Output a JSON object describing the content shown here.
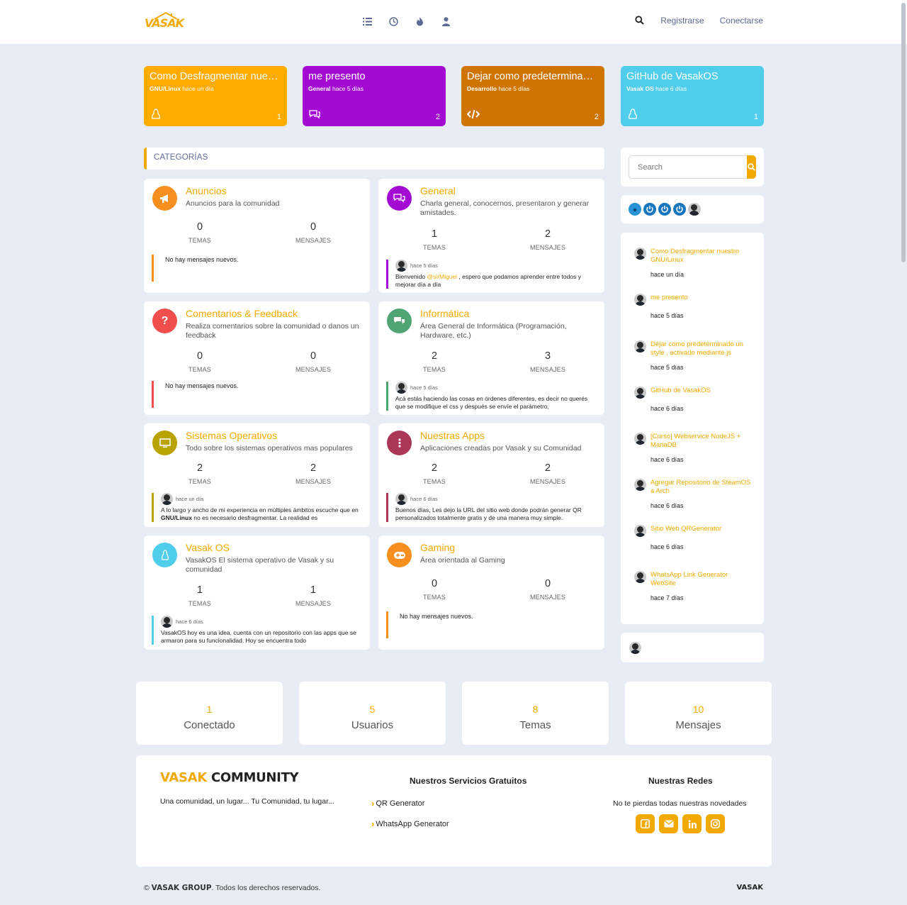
{
  "brand": {
    "logo": "VASAK"
  },
  "topnav": {
    "icons": [
      "list-icon",
      "clock-icon",
      "fire-icon",
      "user-icon"
    ],
    "register": "Registrarse",
    "login": "Conectarse"
  },
  "recent_cards": [
    {
      "title": "Como Desfragmentar nuestr...",
      "category": "GNU/Linux",
      "time": "hace un día",
      "count": "1",
      "color": "#ffab00",
      "icon": "linux-icon"
    },
    {
      "title": "me presento",
      "category": "General",
      "time": "hace 5 días",
      "count": "2",
      "color": "#a30bd3",
      "icon": "comments-icon"
    },
    {
      "title": "Dejar como predeterminado ...",
      "category": "Desarrollo",
      "time": "hace 5 días",
      "count": "2",
      "color": "#cf7400",
      "icon": "code-icon"
    },
    {
      "title": "GitHub de VasakOS",
      "category": "Vasak OS",
      "time": "hace 6 días",
      "count": "1",
      "color": "#4fcdea",
      "icon": "linux-icon"
    }
  ],
  "categories_header": "CATEGORÍAS",
  "categories": [
    {
      "title": "Anuncios",
      "desc": "Anuncios para la comunidad",
      "topics": "0",
      "posts": "0",
      "color": "#f68f1f",
      "icon": "megaphone-icon",
      "last": null
    },
    {
      "title": "General",
      "desc": "Charla general, conocernos, presentaron y generar amistades.",
      "topics": "1",
      "posts": "2",
      "color": "#a30bd3",
      "icon": "comments-icon",
      "last": {
        "time": "hace 5 días",
        "pre": "Bienvenido ",
        "mention": "@sirMiguel",
        "post": " , espero que podamos aprender entre todos y mejorar día a día"
      }
    },
    {
      "title": "Comentarios & Feedback",
      "desc": "Realiza comentarios sobre la comunidad o danos un feedback",
      "topics": "0",
      "posts": "0",
      "color": "#f04d4d",
      "icon": "question-icon",
      "last": null
    },
    {
      "title": "Informática",
      "desc": "Área General de Informática (Programación, Hardware, etc.)",
      "topics": "2",
      "posts": "3",
      "color": "#4fa473",
      "icon": "chat-icon",
      "last": {
        "time": "hace 5 días",
        "pre": "Acá estás haciendo las cosas en órdenes diferentes, es decir no querés que se modifique el css y después se envíe el parámetro,",
        "mention": "",
        "post": ""
      }
    },
    {
      "title": "Sistemas Operativos",
      "desc": "Todo sobre los sistemas operativos mas populares",
      "topics": "2",
      "posts": "2",
      "color": "#b9a300",
      "icon": "monitor-icon",
      "last": {
        "time": "hace un día",
        "pre": "A lo largo y ancho de mi experiencia en múltiples ámbitos escuche que en ",
        "bold": "GNU/Linux",
        "post": " no es necesario desfragmentar. La realidad es"
      }
    },
    {
      "title": "Nuestras Apps",
      "desc": "Aplicaciones creadas por Vasak y su Comunidad",
      "topics": "2",
      "posts": "2",
      "color": "#ab3755",
      "icon": "dots-icon",
      "last": {
        "time": "hace 6 días",
        "pre": "Buenos días, Les dejo la URL del sitio web donde podrán generar QR personalizados totalmente gratis y de una manera muy simple.",
        "mention": "",
        "post": ""
      }
    },
    {
      "title": "Vasak OS",
      "desc": "VasakOS El sistema operativo de Vasak y su comunidad",
      "topics": "1",
      "posts": "1",
      "color": "#4fcdea",
      "icon": "linux-icon",
      "last": {
        "time": "hace 6 días",
        "pre": "VasakOS hoy es una idea, cuenta con un repositorio con las apps que se armaron para su funcionalidad. Hoy se encuentra todo",
        "mention": "",
        "post": ""
      }
    },
    {
      "title": "Gaming",
      "desc": "Área orientada al Gaming",
      "topics": "0",
      "posts": "0",
      "color": "#f68f1f",
      "icon": "gamepad-icon",
      "last": null
    }
  ],
  "labels": {
    "topics": "TEMAS",
    "posts": "MENSAJES",
    "no_posts": "No hay mensajes nuevos."
  },
  "sidebar": {
    "search_placeholder": "Search",
    "recent_topics": [
      {
        "title": "Como Desfragmentar nuestro GNU/Linux",
        "time": "hace un día"
      },
      {
        "title": "me presento",
        "time": "hace 5 días"
      },
      {
        "title": "Dejar como predeterminado un style , activado mediante js",
        "time": "hace 5 días"
      },
      {
        "title": "GitHub de VasakOS",
        "time": "hace 6 días"
      },
      {
        "title": "[Curso] Webservice NodeJS + MariaDB",
        "time": "hace 6 días"
      },
      {
        "title": "Agregar Repositorio de SteamOS a Arch",
        "time": "hace 6 días"
      },
      {
        "title": "Sitio Web QRGenerator",
        "time": "hace 6 días"
      },
      {
        "title": "WhatsApp Link Generator WebSite",
        "time": "hace 7 días"
      }
    ]
  },
  "stats": [
    {
      "num": "1",
      "label": "Conectado"
    },
    {
      "num": "5",
      "label": "Usuarios"
    },
    {
      "num": "8",
      "label": "Temas"
    },
    {
      "num": "10",
      "label": "Mensajes"
    }
  ],
  "footer": {
    "brand_1": "VASAK",
    "brand_2": "COMMUNITY",
    "tagline": "Una comunidad, un lugar... Tu Comunidad, tu lugar...",
    "services_title": "Nuestros Servicios Gratuitos",
    "services": [
      "QR Generator",
      "WhatsApp Generator"
    ],
    "social_title": "Nuestras Redes",
    "social_sub": "No te pierdas todas nuestras novedades",
    "social_icons": [
      "facebook-icon",
      "email-icon",
      "linkedin-icon",
      "instagram-icon"
    ]
  },
  "copyright": {
    "pre": "© ",
    "brand": "VASAK GROUP",
    "post": ". Todos los derechos reservados.",
    "logo": "VASAK"
  },
  "colors": {
    "accent": "#f2a900",
    "nav": "#5b6a92",
    "bg": "#e8edf5"
  }
}
